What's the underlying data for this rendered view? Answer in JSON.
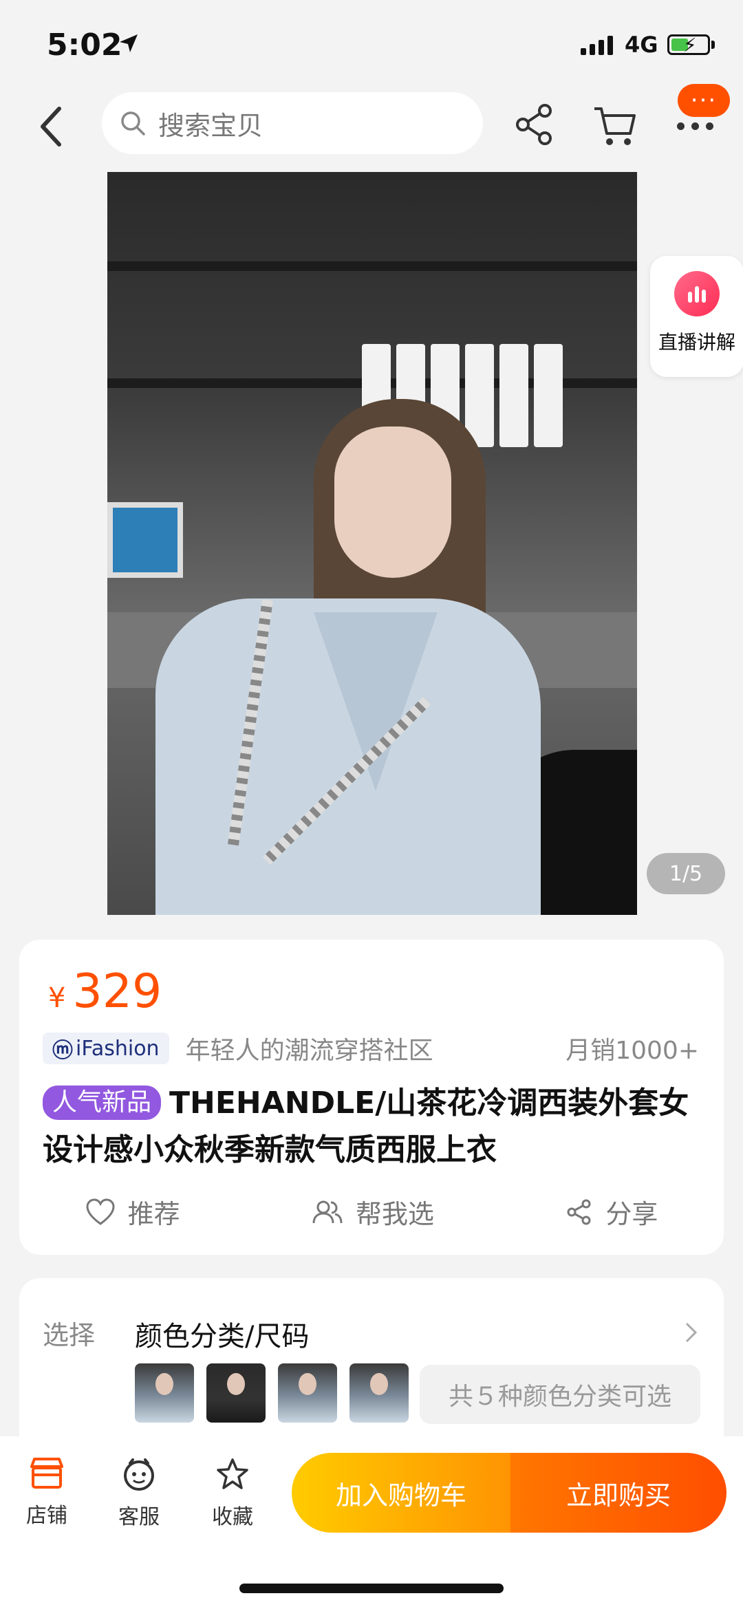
{
  "status_bar": {
    "time": "5:02",
    "network": "4G"
  },
  "search": {
    "placeholder": "搜索宝贝"
  },
  "header": {
    "more_badge": "···"
  },
  "gallery": {
    "live_label": "直播讲解",
    "pager": "1/5"
  },
  "product": {
    "currency": "¥",
    "price": "329",
    "brand": "iFashion",
    "slogan": "年轻人的潮流穿搭社区",
    "sales": "月销1000+",
    "tag": "人气新品",
    "title": "THEHANDLE/山茶花冷调西装外套女设计感小众秋季新款气质西服上衣",
    "actions": {
      "recommend": "推荐",
      "help_choose": "帮我选",
      "share": "分享"
    }
  },
  "options": {
    "label": "选择",
    "value": "颜色分类/尺码",
    "count_text": "共５种颜色分类可选"
  },
  "bottom_bar": {
    "shop": "店铺",
    "service": "客服",
    "favorite": "收藏",
    "add_to_cart": "加入购物车",
    "buy_now": "立即购买"
  },
  "colors": {
    "accent": "#ff5000",
    "tag": "#9258e0",
    "cart_button": "#ff9402",
    "buy_button": "#ff4e00"
  }
}
